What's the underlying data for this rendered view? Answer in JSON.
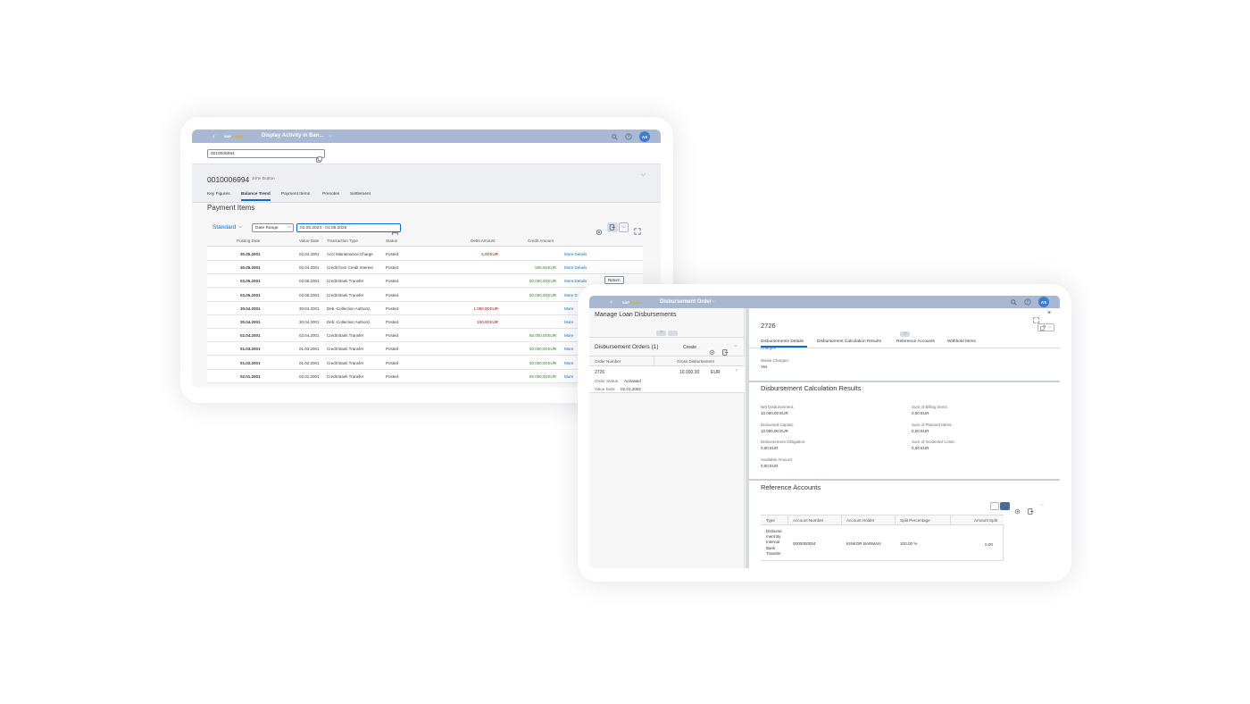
{
  "w1": {
    "app_title": "Display Activity in Ban...",
    "account_input": "0010006994",
    "header": {
      "id": "0010006994",
      "name": "John Dutton"
    },
    "tabs": [
      "Key Figures",
      "Balance Trend",
      "Payment Items",
      "Prenotes",
      "Settlement"
    ],
    "section_title": "Payment Items",
    "variant": "Standard",
    "filter_select": "Date Range",
    "date_range": "01.05.2024 - 01.05.2025",
    "columns": [
      "Posting Date",
      "Value Date",
      "Transaction Type",
      "Status",
      "Debit Amount",
      "Credit Amount"
    ],
    "rows": [
      {
        "posting": "30.05.2001",
        "value": "02.04.2001",
        "type": "Acct Maintenance Charge",
        "status": "Posted",
        "debit": "5,00",
        "credit": "",
        "more": "More Details",
        "extra": ""
      },
      {
        "posting": "30.05.2001",
        "value": "02.04.2001",
        "type": "Credit from Credit Interest",
        "status": "Posted",
        "debit": "",
        "credit": "505,56",
        "more": "More Details",
        "extra": ""
      },
      {
        "posting": "02.05.2001",
        "value": "02.05.2001",
        "type": "Credit Bank Transfer",
        "status": "Posted",
        "debit": "",
        "credit": "50.000,00",
        "more": "More Details",
        "extra": "Return"
      },
      {
        "posting": "02.05.2001",
        "value": "02.05.2001",
        "type": "Credit Bank Transfer",
        "status": "Posted",
        "debit": "",
        "credit": "50.000,00",
        "more": "More D",
        "extra": ""
      },
      {
        "posting": "30.04.2001",
        "value": "30.04.2001",
        "type": "Deb.-Collection Authoriz.",
        "status": "Posted",
        "debit": "1.060,00",
        "credit": "",
        "more": "More",
        "extra": ""
      },
      {
        "posting": "30.04.2001",
        "value": "30.04.2001",
        "type": "Deb.-Collection Authoriz.",
        "status": "Posted",
        "debit": "100,00",
        "credit": "",
        "more": "More",
        "extra": ""
      },
      {
        "posting": "02.04.2001",
        "value": "02.04.2001",
        "type": "Credit Bank Transfer",
        "status": "Posted",
        "debit": "",
        "credit": "50.000,00",
        "more": "More",
        "extra": ""
      },
      {
        "posting": "01.03.2001",
        "value": "01.03.2001",
        "type": "Credit Bank Transfer",
        "status": "Posted",
        "debit": "",
        "credit": "50.000,00",
        "more": "More",
        "extra": ""
      },
      {
        "posting": "01.02.2001",
        "value": "01.02.2001",
        "type": "Credit Bank Transfer",
        "status": "Posted",
        "debit": "",
        "credit": "50.000,00",
        "more": "More",
        "extra": ""
      },
      {
        "posting": "02.01.2001",
        "value": "02.01.2001",
        "type": "Credit Bank Transfer",
        "status": "Posted",
        "debit": "",
        "credit": "50.000,00",
        "more": "More",
        "extra": ""
      }
    ],
    "currency": "EUR"
  },
  "w2": {
    "app_title": "Disbursement Order",
    "list_title": "Manage Loan Disbursements",
    "orders_title": "Disbursement Orders (1)",
    "create": "Create",
    "col_order": "Order Number",
    "col_gross": "Gross Disbursement",
    "order": {
      "number": "2726",
      "amount": "10.000,00",
      "currency": "EUR",
      "status_label": "Order Status:",
      "status": "Activated",
      "date_label": "Value Date:",
      "date": "02.01.2002"
    },
    "detail_title": "2726",
    "tabs": [
      "Disbursements Details",
      "Disbursement Calculation Results",
      "Reference Accounts",
      "Withhold Items"
    ],
    "cut_label": "Charges",
    "waive_label": "Waive Charges:",
    "waive_value": "Yes",
    "calc_title": "Disbursement Calculation Results",
    "calc_left": [
      {
        "label": "Net Disbursement:",
        "value": "10.000,00 EUR"
      },
      {
        "label": "Disbursed Capital:",
        "value": "10.000,00 EUR"
      },
      {
        "label": "Disbursement Obligation:",
        "value": "0,00 EUR"
      },
      {
        "label": "Available Amount:",
        "value": "0,00 EUR"
      }
    ],
    "calc_right": [
      {
        "label": "Sum of Billing Items:",
        "value": "0,00 EUR"
      },
      {
        "label": "Sum of Planned Items:",
        "value": "0,00 EUR"
      },
      {
        "label": "Sum of Incidental Costs:",
        "value": "0,00 EUR"
      }
    ],
    "ref_title": "Reference Accounts",
    "ref_columns": [
      "Type",
      "Account Number",
      "Account Holder",
      "Split Percentage",
      "Amount Split"
    ],
    "ref_row": {
      "type_lines": [
        "Disburse",
        "ment By",
        "Internal",
        "Bank",
        "Transfer"
      ],
      "account": "0000000004",
      "holder": "KINKOR BARMAN",
      "split": "100.00 %",
      "amount": "0,00"
    }
  }
}
